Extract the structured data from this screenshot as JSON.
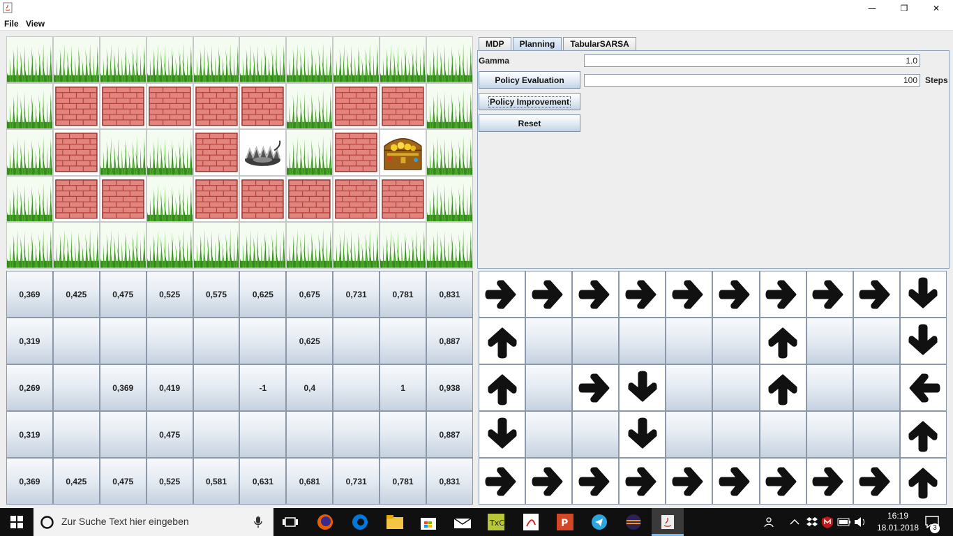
{
  "window": {
    "minimize": "—",
    "maximize": "❐",
    "close": "✕"
  },
  "menu": [
    "File",
    "View"
  ],
  "tabs": [
    "MDP",
    "Planning",
    "TabularSARSA"
  ],
  "panel": {
    "gamma_label": "Gamma",
    "gamma_value": "1.0",
    "policy_eval_label": "Policy Evaluation",
    "steps_value": "100",
    "steps_label": "Steps",
    "policy_improve_label": "Policy Improvement",
    "reset_label": "Reset"
  },
  "grid": [
    [
      "grass",
      "grass",
      "grass",
      "grass",
      "grass",
      "grass",
      "grass",
      "grass",
      "grass",
      "grass"
    ],
    [
      "grass",
      "wall",
      "wall",
      "wall",
      "wall",
      "wall",
      "grass",
      "wall",
      "wall",
      "grass"
    ],
    [
      "grass",
      "wall",
      "grass",
      "grass",
      "wall",
      "trap",
      "grass",
      "wall",
      "treasure",
      "grass"
    ],
    [
      "grass",
      "wall",
      "wall",
      "grass",
      "wall",
      "wall",
      "wall",
      "wall",
      "wall",
      "grass"
    ],
    [
      "grass",
      "grass",
      "grass",
      "grass",
      "grass",
      "grass",
      "grass",
      "grass",
      "grass",
      "grass"
    ]
  ],
  "values": [
    [
      "0,369",
      "0,425",
      "0,475",
      "0,525",
      "0,575",
      "0,625",
      "0,675",
      "0,731",
      "0,781",
      "0,831"
    ],
    [
      "0,319",
      "",
      "",
      "",
      "",
      "",
      "0,625",
      "",
      "",
      "0,887"
    ],
    [
      "0,269",
      "",
      "0,369",
      "0,419",
      "",
      "-1",
      "0,4",
      "",
      "1",
      "0,938"
    ],
    [
      "0,319",
      "",
      "",
      "0,475",
      "",
      "",
      "",
      "",
      "",
      "0,887"
    ],
    [
      "0,369",
      "0,425",
      "0,475",
      "0,525",
      "0,581",
      "0,631",
      "0,681",
      "0,731",
      "0,781",
      "0,831"
    ]
  ],
  "policy": [
    [
      "right",
      "right",
      "right",
      "right",
      "right",
      "right",
      "right",
      "right",
      "right",
      "down"
    ],
    [
      "up",
      "",
      "",
      "",
      "",
      "",
      "up",
      "",
      "",
      "down"
    ],
    [
      "up",
      "",
      "right",
      "down",
      "",
      "",
      "up",
      "",
      "",
      "left"
    ],
    [
      "down",
      "",
      "",
      "down",
      "",
      "",
      "",
      "",
      "",
      "up"
    ],
    [
      "right",
      "right",
      "right",
      "right",
      "right",
      "right",
      "right",
      "right",
      "right",
      "up"
    ]
  ],
  "taskbar": {
    "search_placeholder": "Zur Suche Text hier eingeben",
    "time": "16:19",
    "date": "18.01.2018",
    "notifications": "3"
  }
}
